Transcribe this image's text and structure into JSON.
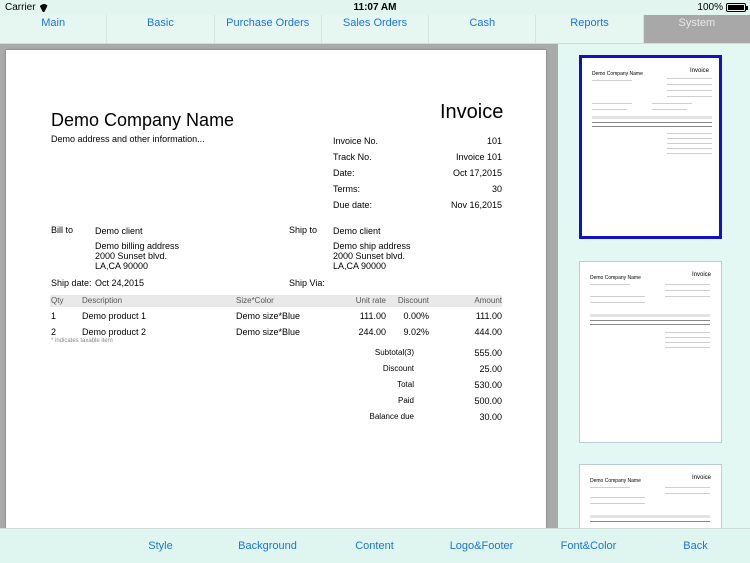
{
  "status": {
    "carrier": "Carrier",
    "time": "11:07 AM",
    "battery": "100%"
  },
  "tabs": [
    {
      "label": "Main"
    },
    {
      "label": "Basic"
    },
    {
      "label": "Purchase Orders"
    },
    {
      "label": "Sales Orders"
    },
    {
      "label": "Cash"
    },
    {
      "label": "Reports"
    },
    {
      "label": "System"
    }
  ],
  "invoice": {
    "company_name": "Demo Company Name",
    "address": "Demo address and other information...",
    "title": "Invoice",
    "info": [
      {
        "label": "Invoice No.",
        "value": "101"
      },
      {
        "label": "Track No.",
        "value": "Invoice 101"
      },
      {
        "label": "Date:",
        "value": "Oct 17,2015"
      },
      {
        "label": "Terms:",
        "value": "30"
      },
      {
        "label": "Due date:",
        "value": "Nov 16,2015"
      }
    ],
    "bill_to_label": "Bill to",
    "bill_to": {
      "name": "Demo client",
      "line1": "Demo billing address",
      "line2": "2000 Sunset blvd.",
      "line3": "LA,CA 90000"
    },
    "ship_to_label": "Ship to",
    "ship_to": {
      "name": "Demo client",
      "line1": "Demo ship address",
      "line2": "2000 Sunset blvd.",
      "line3": "LA,CA 90000"
    },
    "ship_date_label": "Ship date:",
    "ship_date": "Oct 24,2015",
    "ship_via_label": "Ship Via:",
    "columns": {
      "qty": "Qty",
      "description": "Description",
      "size_color": "Size*Color",
      "unit_rate": "Unit rate",
      "discount": "Discount",
      "amount": "Amount"
    },
    "items": [
      {
        "qty": "1",
        "description": "Demo product 1",
        "size_color": "Demo size*Blue",
        "unit_rate": "111.00",
        "discount": "0.00%",
        "amount": "111.00"
      },
      {
        "qty": "2",
        "description": "Demo product 2",
        "size_color": "Demo size*Blue",
        "unit_rate": "244.00",
        "discount": "9.02%",
        "amount": "444.00"
      }
    ],
    "tax_note": "* indicates taxable item",
    "totals": [
      {
        "label": "Subtotal(3)",
        "value": "555.00"
      },
      {
        "label": "Discount",
        "value": "25.00"
      },
      {
        "label": "Total",
        "value": "530.00"
      },
      {
        "label": "Paid",
        "value": "500.00"
      },
      {
        "label": "Balance due",
        "value": "30.00"
      }
    ]
  },
  "thumbnails": [
    {
      "company": "Demo Company Name",
      "title": "Invoice",
      "selected": true
    },
    {
      "company": "Demo Company Name",
      "title": "Invoice",
      "selected": false
    },
    {
      "company": "Demo Company Name",
      "title": "Invoice",
      "selected": false
    }
  ],
  "toolbar": [
    {
      "label": "Style"
    },
    {
      "label": "Background"
    },
    {
      "label": "Content"
    },
    {
      "label": "Logo&Footer"
    },
    {
      "label": "Font&Color"
    },
    {
      "label": "Back"
    }
  ]
}
